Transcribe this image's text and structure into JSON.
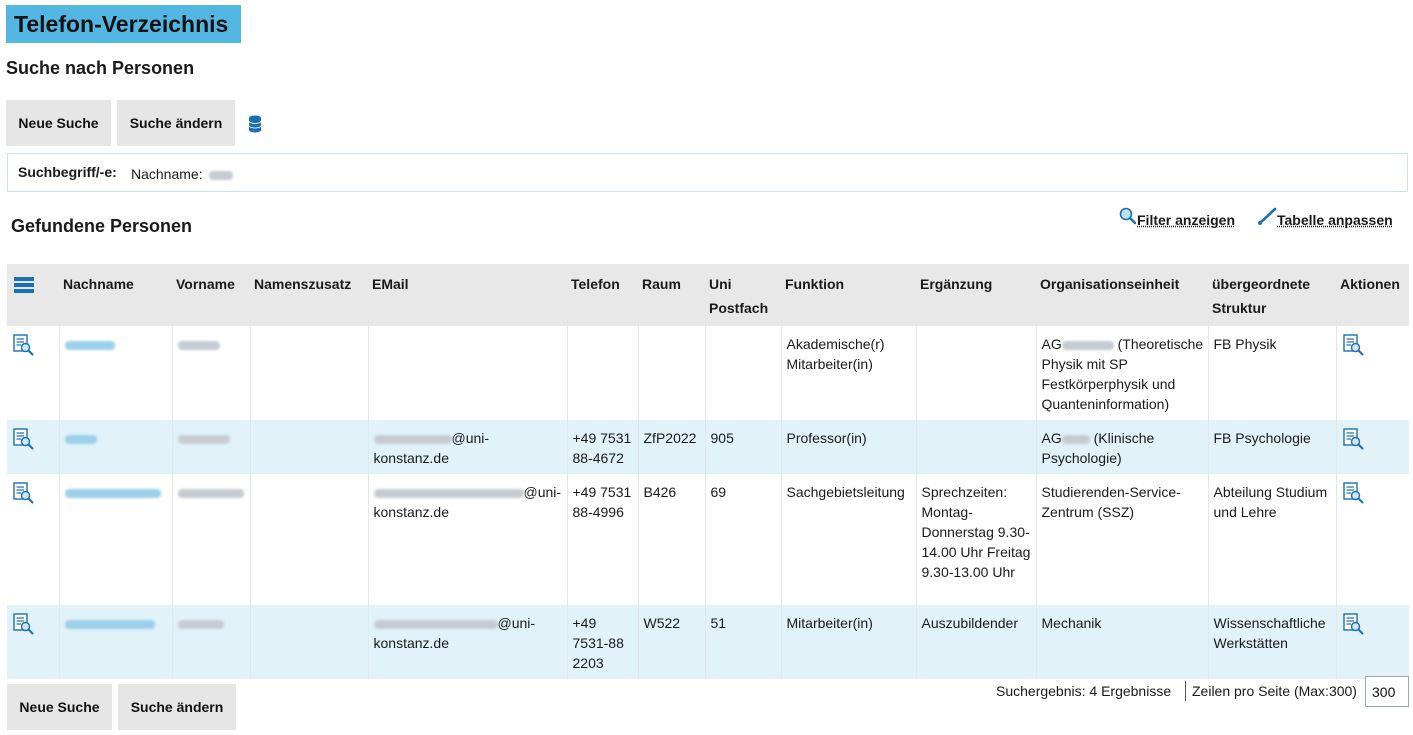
{
  "page": {
    "title": "Telefon-Verzeichnis",
    "section_title": "Suche nach Personen"
  },
  "toolbar": {
    "new_search": "Neue Suche",
    "change_search": "Suche ändern",
    "db_icon": "database-icon"
  },
  "criteria": {
    "label": "Suchbegriff/-e:",
    "value_prefix": "Nachname:"
  },
  "results": {
    "title": "Gefundene Personen",
    "filter_label": "Filter anzeigen",
    "adjust_label": "Tabelle anpassen",
    "columns": [
      "Nachname",
      "Vorname",
      "Namenszusatz",
      "EMail",
      "Telefon",
      "Raum",
      "Uni Postfach",
      "Funktion",
      "Ergänzung",
      "Organisationseinheit",
      "übergeordnete Struktur",
      "Aktionen"
    ],
    "rows": [
      {
        "email_suffix": "",
        "telefon": "",
        "raum": "",
        "postfach": "",
        "funktion": "Akademische(r) Mitarbeiter(in)",
        "ergaenzung": "",
        "org_prefix": "AG",
        "org_suffix": "(Theoretische Physik mit SP Festkörperphysik und Quanteninformation)",
        "struktur": "FB Physik"
      },
      {
        "email_suffix": "@uni-konstanz.de",
        "telefon": "+49 7531 88-4672",
        "raum": "ZfP2022",
        "postfach": "905",
        "funktion": "Professor(in)",
        "ergaenzung": "",
        "org_prefix": "AG",
        "org_suffix": "(Klinische Psychologie)",
        "struktur": "FB Psychologie"
      },
      {
        "email_suffix": "@uni-konstanz.de",
        "telefon": "+49 7531 88-4996",
        "raum": "B426",
        "postfach": "69",
        "funktion": "Sachgebietsleitung",
        "ergaenzung": "Sprechzeiten: Montag-Donnerstag 9.30-14.00 Uhr Freitag 9.30-13.00 Uhr",
        "org_prefix": "Studierenden-Service-Zentrum (SSZ)",
        "org_suffix": "",
        "struktur": "Abteilung Studium und Lehre"
      },
      {
        "email_suffix": "@uni-konstanz.de",
        "telefon": "+49 7531-88 2203",
        "raum": "W522",
        "postfach": "51",
        "funktion": "Mitarbeiter(in)",
        "ergaenzung": "Auszubildender",
        "org_prefix": "Mechanik",
        "org_suffix": "",
        "struktur": "Wissenschaftliche Werkstätten"
      }
    ]
  },
  "footer": {
    "result_text": "Suchergebnis: 4 Ergebnisse",
    "rows_label": "Zeilen pro Seite (Max:300)",
    "rows_value": "300"
  },
  "colors": {
    "title_bg": "#52b8e3",
    "button_bg": "#e6e6e6",
    "alt_row": "#e1f2f9",
    "header_bg": "#e8e8e8",
    "icon_blue": "#1b6fb4"
  }
}
